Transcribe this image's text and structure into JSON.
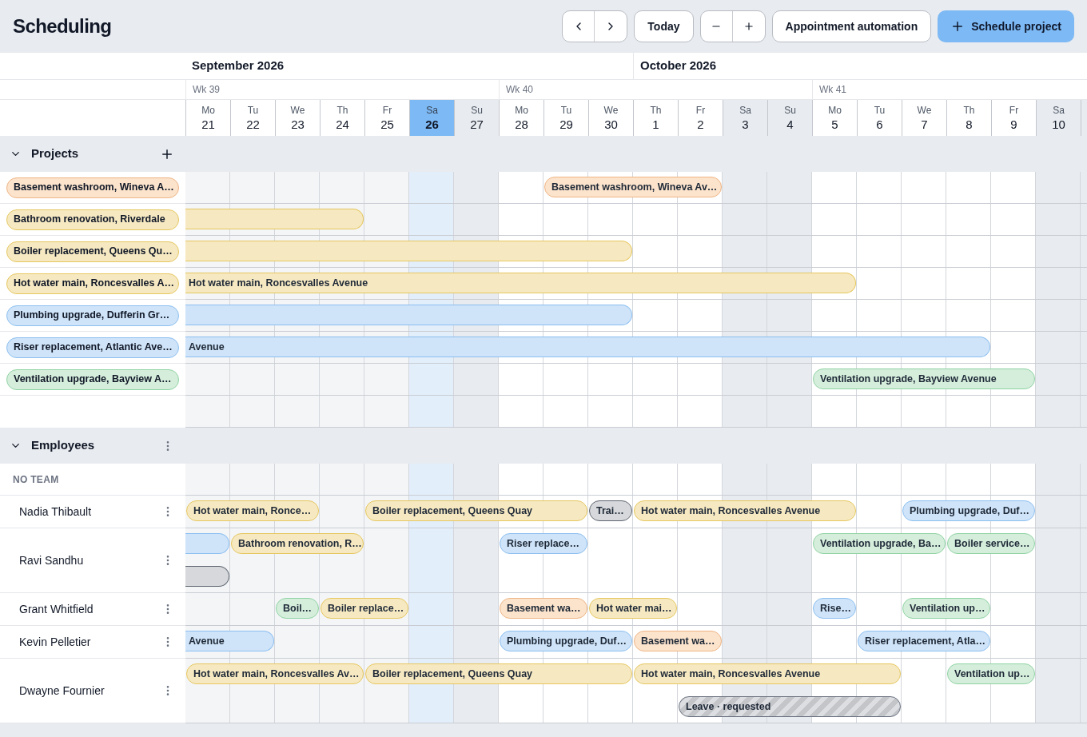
{
  "title": "Scheduling",
  "toolbar": {
    "today": "Today",
    "automation": "Appointment automation",
    "schedule": "Schedule project"
  },
  "months": [
    {
      "label": "September 2026"
    },
    {
      "label": "October 2026"
    }
  ],
  "weeks": [
    {
      "label": "Wk 39"
    },
    {
      "label": "Wk 40"
    },
    {
      "label": "Wk 41"
    }
  ],
  "days": [
    {
      "day": "Mo",
      "date": "21",
      "weekend": false,
      "selected": false
    },
    {
      "day": "Tu",
      "date": "22",
      "weekend": false,
      "selected": false
    },
    {
      "day": "We",
      "date": "23",
      "weekend": false,
      "selected": false
    },
    {
      "day": "Th",
      "date": "24",
      "weekend": false,
      "selected": false
    },
    {
      "day": "Fr",
      "date": "25",
      "weekend": false,
      "selected": false
    },
    {
      "day": "Sa",
      "date": "26",
      "weekend": true,
      "selected": true
    },
    {
      "day": "Su",
      "date": "27",
      "weekend": true,
      "selected": false
    },
    {
      "day": "Mo",
      "date": "28",
      "weekend": false,
      "selected": false
    },
    {
      "day": "Tu",
      "date": "29",
      "weekend": false,
      "selected": false
    },
    {
      "day": "We",
      "date": "30",
      "weekend": false,
      "selected": false
    },
    {
      "day": "Th",
      "date": "1",
      "weekend": false,
      "selected": false
    },
    {
      "day": "Fr",
      "date": "2",
      "weekend": false,
      "selected": false
    },
    {
      "day": "Sa",
      "date": "3",
      "weekend": true,
      "selected": false
    },
    {
      "day": "Su",
      "date": "4",
      "weekend": true,
      "selected": false
    },
    {
      "day": "Mo",
      "date": "5",
      "weekend": false,
      "selected": false
    },
    {
      "day": "Tu",
      "date": "6",
      "weekend": false,
      "selected": false
    },
    {
      "day": "We",
      "date": "7",
      "weekend": false,
      "selected": false
    },
    {
      "day": "Th",
      "date": "8",
      "weekend": false,
      "selected": false
    },
    {
      "day": "Fr",
      "date": "9",
      "weekend": false,
      "selected": false
    },
    {
      "day": "Sa",
      "date": "10",
      "weekend": true,
      "selected": false
    }
  ],
  "projects": {
    "label": "Projects",
    "expanded": true,
    "rows": [
      {
        "name": "Basement washroom, Wineva A…",
        "color": "#fbe3cc",
        "bars": [
          {
            "kind": "event",
            "color": "#fbe3cc",
            "text": "Basement washroom, Wineva Av…"
          }
        ]
      },
      {
        "name": "Bathroom renovation, Riverdale",
        "color": "#f6e9c2",
        "bars": [
          {
            "kind": "event",
            "color": "#f6e9c2"
          }
        ]
      },
      {
        "name": "Boiler replacement, Queens Qu…",
        "color": "#f6e9c2",
        "bars": [
          {
            "kind": "event",
            "color": "#f6e9c2"
          }
        ]
      },
      {
        "name": "Hot water main, Roncesvalles A…",
        "color": "#f6e9c2",
        "bars": [
          {
            "kind": "event",
            "color": "#f6e9c2",
            "text": "Hot water main, Roncesvalles Avenue"
          }
        ]
      },
      {
        "name": "Plumbing upgrade, Dufferin Gr…",
        "color": "#cfe4f9",
        "bars": [
          {
            "kind": "event",
            "color": "#cfe4f9"
          }
        ]
      },
      {
        "name": "Riser replacement, Atlantic Ave…",
        "color": "#cfe4f9",
        "bars": [
          {
            "kind": "event",
            "color": "#cfe4f9",
            "text": "Avenue"
          }
        ]
      },
      {
        "name": "Ventilation upgrade, Bayview A…",
        "color": "#d5eedc",
        "bars": [
          {
            "kind": "event",
            "color": "#d5eedc",
            "text": "Ventilation upgrade, Bayview Avenue"
          }
        ]
      }
    ]
  },
  "employees": {
    "label": "Employees",
    "expanded": true,
    "team": "NO TEAM",
    "rows": [
      {
        "name": "Nadia Thibault",
        "lanes": [
          [
            {
              "kind": "event",
              "color": "#f6e9c2",
              "text": "Hot water main, Ronce…"
            },
            {
              "kind": "event",
              "color": "#f6e9c2",
              "text": "Boiler replacement, Queens Quay"
            },
            {
              "kind": "event",
              "color": "#d6d8db",
              "text": "Trai…"
            },
            {
              "kind": "event",
              "color": "#f6e9c2",
              "text": "Hot water main, Roncesvalles Avenue"
            },
            {
              "kind": "event",
              "color": "#cfe4f9",
              "text": "Plumbing upgrade, Duf…"
            }
          ]
        ]
      },
      {
        "name": "Ravi Sandhu",
        "lanes": [
          [
            {
              "kind": "event",
              "color": "#cfe4f9"
            },
            {
              "kind": "event",
              "color": "#f6e9c2",
              "text": "Bathroom renovation, R…"
            },
            {
              "kind": "event",
              "color": "#cfe4f9",
              "text": "Riser replace…"
            },
            {
              "kind": "event",
              "color": "#d5eedc",
              "text": "Ventilation upgrade, Ba…"
            },
            {
              "kind": "event",
              "color": "#d5eedc",
              "text": "Boiler service…"
            }
          ],
          [
            {
              "kind": "event",
              "color": "#d6d8db"
            }
          ]
        ]
      },
      {
        "name": "Grant Whitfield",
        "lanes": [
          [
            {
              "kind": "event",
              "color": "#d5eedc",
              "text": "Boil…"
            },
            {
              "kind": "event",
              "color": "#f6e9c2",
              "text": "Boiler replace…"
            },
            {
              "kind": "event",
              "color": "#fbe3cc",
              "text": "Basement wa…"
            },
            {
              "kind": "event",
              "color": "#f6e9c2",
              "text": "Hot water mai…"
            },
            {
              "kind": "event",
              "color": "#cfe4f9",
              "text": "Rise…"
            },
            {
              "kind": "event",
              "color": "#d5eedc",
              "text": "Ventilation up…"
            }
          ]
        ]
      },
      {
        "name": "Kevin Pelletier",
        "lanes": [
          [
            {
              "kind": "event",
              "color": "#cfe4f9",
              "text": "Avenue"
            },
            {
              "kind": "event",
              "color": "#cfe4f9",
              "text": "Plumbing upgrade, Duf…"
            },
            {
              "kind": "event",
              "color": "#fbe3cc",
              "text": "Basement wa…"
            },
            {
              "kind": "event",
              "color": "#cfe4f9",
              "text": "Riser replacement, Atla…"
            }
          ]
        ]
      },
      {
        "name": "Dwayne Fournier",
        "lanes": [
          [
            {
              "kind": "event",
              "color": "#f6e9c2",
              "text": "Hot water main, Roncesvalles Av…"
            },
            {
              "kind": "event",
              "color": "#f6e9c2",
              "text": "Boiler replacement, Queens Quay"
            },
            {
              "kind": "event",
              "color": "#f6e9c2",
              "text": "Hot water main, Roncesvalles Avenue"
            },
            {
              "kind": "event",
              "color": "#d5eedc",
              "text": "Ventilation up…"
            }
          ],
          [
            {
              "kind": "leave",
              "text": "Leave · requested"
            }
          ]
        ]
      }
    ]
  }
}
